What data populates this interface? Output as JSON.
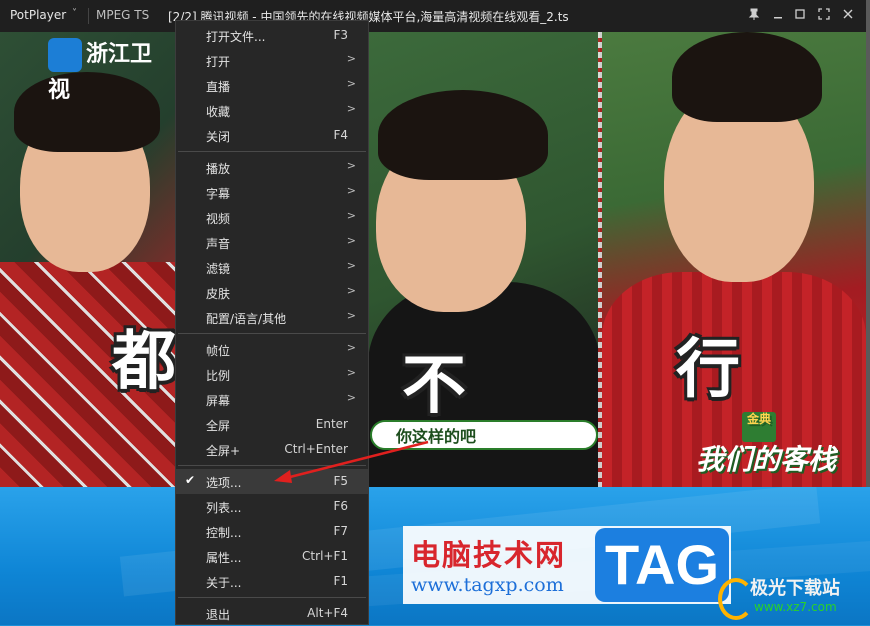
{
  "titlebar": {
    "brand": "PotPlayer",
    "brand_arrow": "˅",
    "codec": "MPEG TS",
    "title": "[2/2] 腾讯视频 - 中国领先的在线视频媒体平台,海量高清视频在线观看_2.ts",
    "buttons": [
      "pin-icon",
      "minimize-icon",
      "maximize-icon",
      "fullscreen-icon",
      "close-icon"
    ]
  },
  "video": {
    "channel_logo": "浙江卫视",
    "captions": [
      "都",
      "不",
      "行"
    ],
    "subtitle": "你这样的吧",
    "show_brand": "金典",
    "show_logo": "我们的客栈"
  },
  "menu": {
    "groups": [
      [
        {
          "label": "打开文件...",
          "shortcut": "F3"
        },
        {
          "label": "打开",
          "submenu": true
        },
        {
          "label": "直播",
          "submenu": true
        },
        {
          "label": "收藏",
          "submenu": true
        },
        {
          "label": "关闭",
          "shortcut": "F4"
        }
      ],
      [
        {
          "label": "播放",
          "submenu": true
        },
        {
          "label": "字幕",
          "submenu": true
        },
        {
          "label": "视频",
          "submenu": true
        },
        {
          "label": "声音",
          "submenu": true
        },
        {
          "label": "滤镜",
          "submenu": true
        },
        {
          "label": "皮肤",
          "submenu": true
        },
        {
          "label": "配置/语言/其他",
          "submenu": true
        }
      ],
      [
        {
          "label": "帧位",
          "submenu": true
        },
        {
          "label": "比例",
          "submenu": true
        },
        {
          "label": "屏幕",
          "submenu": true
        },
        {
          "label": "全屏",
          "shortcut": "Enter"
        },
        {
          "label": "全屏+",
          "shortcut": "Ctrl+Enter"
        }
      ],
      [
        {
          "label": "选项...",
          "shortcut": "F5",
          "checked": true,
          "active": true
        },
        {
          "label": "列表...",
          "shortcut": "F6"
        },
        {
          "label": "控制...",
          "shortcut": "F7"
        },
        {
          "label": "属性...",
          "shortcut": "Ctrl+F1"
        },
        {
          "label": "关于...",
          "shortcut": "F1"
        }
      ],
      [
        {
          "label": "退出",
          "shortcut": "Alt+F4"
        }
      ]
    ],
    "arrow_glyph": ">",
    "check_glyph": "✔"
  },
  "watermark": {
    "cn": "电脑技术网",
    "url": "www.tagxp.com",
    "tag": "TAG",
    "cn2": "极光下载站",
    "url2": "www.xz7.com"
  },
  "colors": {
    "arrow": "#e0201e",
    "menu_bg": "#272727",
    "desktop": "#1a8fd8"
  }
}
